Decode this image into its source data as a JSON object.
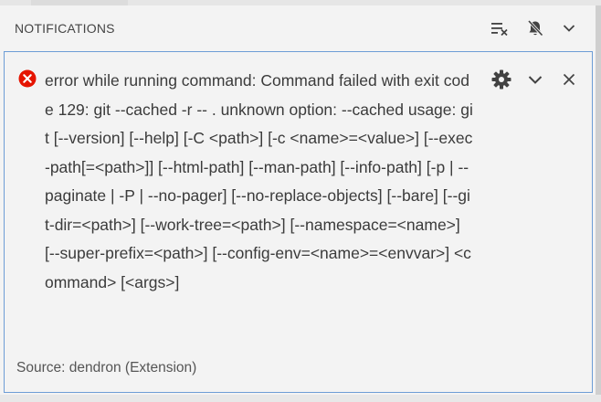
{
  "panel": {
    "title": "NOTIFICATIONS",
    "actions": [
      {
        "name": "clear-all-notifications",
        "icon": "clear-all-icon"
      },
      {
        "name": "do-not-disturb",
        "icon": "bell-slash-icon"
      },
      {
        "name": "hide-notifications",
        "icon": "chevron-down-icon"
      }
    ]
  },
  "notification": {
    "severity": "error",
    "icon": "error-circle-icon",
    "message": "error while running command: Command failed with exit code 129: git --cached -r -- . unknown option: --cached usage: git [--version] [--help] [-C <path>] [-c <name>=<value>] [--exec-path[=<path>]] [--html-path] [--man-path] [--info-path] [-p | --paginate | -P | --no-pager] [--no-replace-objects] [--bare] [--git-dir=<path>] [--work-tree=<path>] [--namespace=<name>] [--super-prefix=<path>] [--config-env=<name>=<envvar>] <command> [<args>]",
    "source": "Source: dendron (Extension)",
    "actions": [
      {
        "name": "configure-notification",
        "icon": "gear-icon"
      },
      {
        "name": "collapse-notification",
        "icon": "chevron-down-icon"
      },
      {
        "name": "clear-notification",
        "icon": "close-icon"
      }
    ]
  },
  "colors": {
    "panel_bg": "#f3f3f3",
    "focus_border": "#6d9dd6",
    "error_red": "#e51400",
    "text": "#3b3b3b"
  }
}
